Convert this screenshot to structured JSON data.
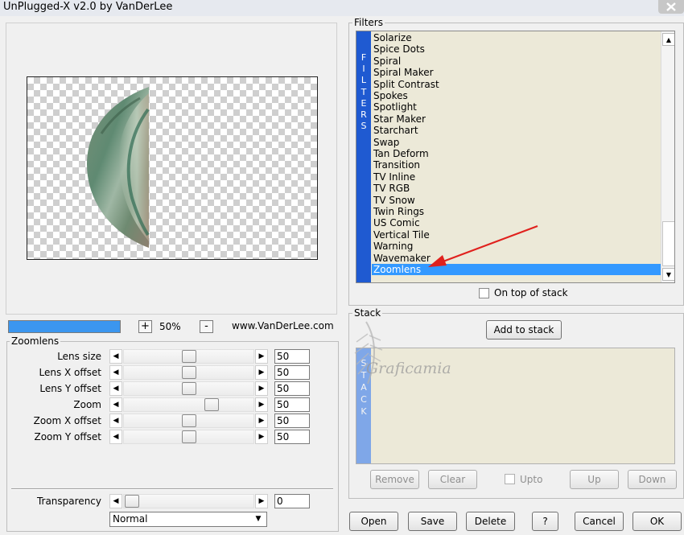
{
  "window": {
    "title": "UnPlugged-X v2.0 by VanDerLee"
  },
  "icons": {
    "close": "close-icon",
    "arrow_left": "arrow-left-icon",
    "arrow_right": "arrow-right-icon",
    "arrow_up": "arrow-up-icon",
    "arrow_down": "arrow-down-icon"
  },
  "preview": {
    "progress_fraction": 1.0,
    "zoom_plus": "+",
    "zoom_value": "50%",
    "zoom_minus": "-",
    "website": "www.VanDerLee.com"
  },
  "zoomlens": {
    "title": "Zoomlens",
    "params": [
      {
        "label": "Lens size",
        "value": "50",
        "slider_fraction": 0.5
      },
      {
        "label": "Lens X offset",
        "value": "50",
        "slider_fraction": 0.5
      },
      {
        "label": "Lens Y offset",
        "value": "50",
        "slider_fraction": 0.5
      },
      {
        "label": "Zoom",
        "value": "50",
        "slider_fraction": 0.7
      },
      {
        "label": "Zoom X offset",
        "value": "50",
        "slider_fraction": 0.5
      },
      {
        "label": "Zoom Y offset",
        "value": "50",
        "slider_fraction": 0.5
      }
    ],
    "transparency": {
      "label": "Transparency",
      "value": "0",
      "slider_fraction": 0.0
    },
    "blend_mode": "Normal"
  },
  "filters": {
    "title": "Filters",
    "tab_letters": [
      "F",
      "I",
      "L",
      "T",
      "E",
      "R",
      "S"
    ],
    "items": [
      "Solarize",
      "Spice Dots",
      "Spiral",
      "Spiral Maker",
      "Split Contrast",
      "Spokes",
      "Spotlight",
      "Star Maker",
      "Starchart",
      "Swap",
      "Tan Deform",
      "Transition",
      "TV Inline",
      "TV RGB",
      "TV Snow",
      "Twin Rings",
      "US Comic",
      "Vertical Tile",
      "Warning",
      "Wavemaker",
      "Zoomlens"
    ],
    "selected": "Zoomlens",
    "on_top_label": "On top of stack"
  },
  "stack": {
    "title": "Stack",
    "add_label": "Add to stack",
    "tab_letters": [
      "S",
      "T",
      "A",
      "C",
      "K"
    ],
    "remove_label": "Remove",
    "clear_label": "Clear",
    "upto_label": "Upto",
    "up_label": "Up",
    "down_label": "Down"
  },
  "buttons": {
    "open": "Open",
    "save": "Save",
    "delete": "Delete",
    "help": "?",
    "cancel": "Cancel",
    "ok": "OK"
  },
  "watermark": {
    "text": "Graficamia"
  },
  "colors": {
    "selection": "#3399ff",
    "filters_tab": "#1f5ad1",
    "stack_tab": "#7fa7e8",
    "list_bg": "#ece9d8",
    "annotation_arrow": "#e0211d"
  }
}
